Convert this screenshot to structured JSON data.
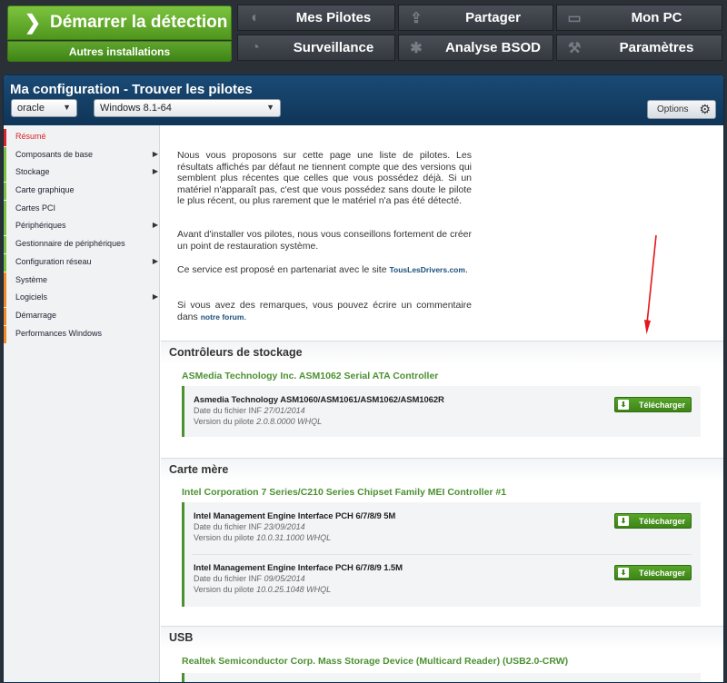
{
  "top": {
    "start_label": "Démarrer la détection",
    "start_icon": "chevron-right-icon",
    "other_label": "Autres installations",
    "nav": [
      {
        "label": "Mes Pilotes",
        "icon": "compass-icon"
      },
      {
        "label": "Partager",
        "icon": "upload-icon"
      },
      {
        "label": "Mon PC",
        "icon": "monitor-icon"
      },
      {
        "label": "Surveillance",
        "icon": "gauge-icon"
      },
      {
        "label": "Analyse BSOD",
        "icon": "bug-icon"
      },
      {
        "label": "Paramètres",
        "icon": "wrench-icon"
      }
    ]
  },
  "panel": {
    "title": "Ma configuration - Trouver les pilotes",
    "machine_select": "oracle",
    "os_select": "Windows 8.1-64",
    "options_label": "Options"
  },
  "sidebar": {
    "items": [
      {
        "label": "Résumé",
        "submenu": false
      },
      {
        "label": "Composants de base",
        "submenu": true
      },
      {
        "label": "Stockage",
        "submenu": true
      },
      {
        "label": "Carte graphique",
        "submenu": false
      },
      {
        "label": "Cartes PCI",
        "submenu": false
      },
      {
        "label": "Périphériques",
        "submenu": true
      },
      {
        "label": "Gestionnaire de périphériques",
        "submenu": false
      },
      {
        "label": "Configuration réseau",
        "submenu": true
      },
      {
        "label": "Système",
        "submenu": false
      },
      {
        "label": "Logiciels",
        "submenu": true
      },
      {
        "label": "Démarrage",
        "submenu": false
      },
      {
        "label": "Performances Windows",
        "submenu": false
      }
    ]
  },
  "intro": {
    "p1": "Nous vous proposons sur cette page une liste de pilotes. Les résultats affichés par défaut ne tiennent compte que des versions qui semblent plus récentes que celles que vous possédez déjà. Si un matériel n'apparaît pas, c'est que vous possédez sans doute le pilote le plus récent, ou plus rarement que le matériel n'a pas été détecté.",
    "p2": "Avant d'installer vos pilotes, nous vous conseillons fortement de créer un point de restauration système.",
    "p3_text": "Ce service est proposé en partenariat avec le site",
    "p3_link": "TousLesDrivers.com",
    "p3_end": ".",
    "p4_text": "Si vous avez des remarques, vous pouvez écrire un commentaire dans",
    "p4_link": "notre forum",
    "p4_end": "."
  },
  "download_label": "Télécharger",
  "date_prefix": "Date du fichier INF",
  "version_prefix": "Version du pilote",
  "sections": [
    {
      "title": "Contrôleurs de stockage",
      "device": "ASMedia Technology Inc. ASM1062 Serial ATA Controller",
      "drivers": [
        {
          "name": "Asmedia Technology ASM1060/ASM1061/ASM1062/ASM1062R",
          "date": "27/01/2014",
          "version": "2.0.8.0000 WHQL"
        }
      ]
    },
    {
      "title": "Carte mère",
      "device": "Intel Corporation 7 Series/C210 Series Chipset Family MEI Controller #1",
      "drivers": [
        {
          "name": "Intel Management Engine Interface PCH 6/7/8/9 5M",
          "date": "23/09/2014",
          "version": "10.0.31.1000 WHQL"
        },
        {
          "name": "Intel Management Engine Interface PCH 6/7/8/9 1.5M",
          "date": "09/05/2014",
          "version": "10.0.25.1048 WHQL"
        }
      ]
    },
    {
      "title": "USB",
      "device": "Realtek Semiconductor Corp. Mass Storage Device (Multicard Reader) (USB2.0-CRW)",
      "drivers": []
    }
  ],
  "colors": {
    "accent_green": "#4c9132",
    "header_blue": "#0f3558",
    "active_red": "#d9242b",
    "annotation_arrow": "#e3171c"
  }
}
